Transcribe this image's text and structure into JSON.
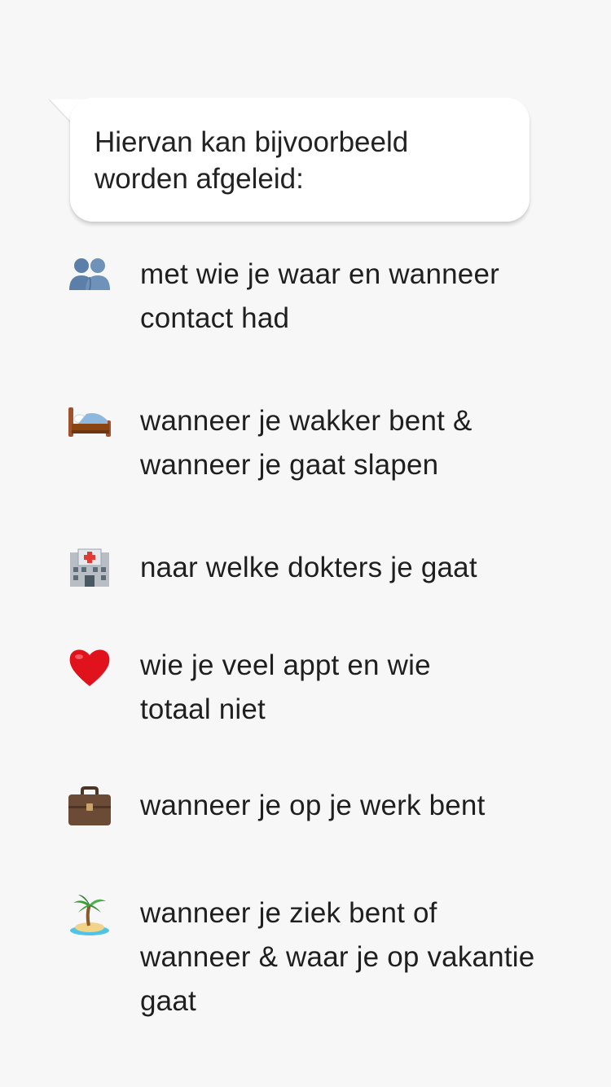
{
  "bubble": {
    "text": "Hiervan kan bijvoorbeeld\nworden afgeleid:"
  },
  "items": [
    {
      "icon": "two-people-icon",
      "text": "met wie je waar en wanneer\ncontact had"
    },
    {
      "icon": "bed-icon",
      "text": "wanneer je wakker bent &\nwanneer je gaat slapen"
    },
    {
      "icon": "hospital-icon",
      "text": "naar welke dokters je gaat"
    },
    {
      "icon": "red-heart-icon",
      "text": "wie je veel appt en wie\ntotaal niet"
    },
    {
      "icon": "briefcase-icon",
      "text": "wanneer je op je werk bent"
    },
    {
      "icon": "desert-island-icon",
      "text": "wanneer je ziek bent of\nwanneer & waar je op vakantie\ngaat"
    }
  ],
  "colors": {
    "background": "#f7f7f7",
    "bubble": "#ffffff",
    "text": "#1f1f1f"
  }
}
